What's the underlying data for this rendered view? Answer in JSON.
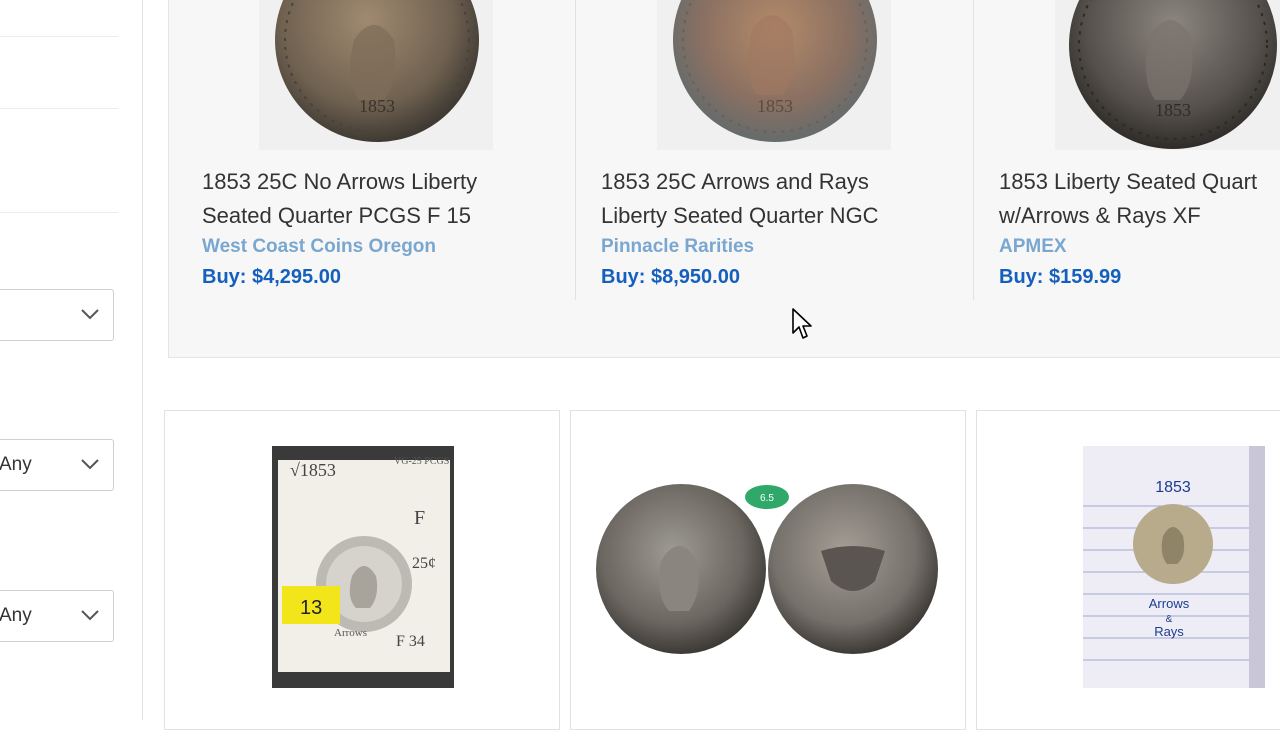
{
  "sidebar": {
    "filters": [
      {
        "value": ""
      },
      {
        "value": "Any"
      },
      {
        "value": "Any"
      }
    ]
  },
  "sponsored": [
    {
      "title_line1": "1853 25C No Arrows Liberty",
      "title_line2": "Seated Quarter PCGS F 15",
      "seller": "West Coast Coins Oregon",
      "price": "Buy: $4,295.00"
    },
    {
      "title_line1": "1853 25C Arrows and Rays",
      "title_line2": "Liberty Seated Quarter NGC",
      "seller": "Pinnacle Rarities",
      "price": "Buy: $8,950.00"
    },
    {
      "title_line1": "1853 Liberty Seated Quart",
      "title_line2": "w/Arrows & Rays XF",
      "seller": "APMEX",
      "price": "Buy: $159.99"
    }
  ],
  "results": [
    {
      "photo_notes": {
        "year": "√1853",
        "grade": "F",
        "denom": "25¢",
        "tag": "13",
        "sub": "Arrows",
        "price_note": "F 34",
        "corner": "VG-25 PCGS"
      }
    },
    {
      "photo_notes": {
        "sticker": "6.5"
      }
    },
    {
      "photo_notes": {
        "year": "1853",
        "caption1": "Arrows",
        "caption2": "&",
        "caption3": "Rays"
      }
    }
  ],
  "colors": {
    "link": "#1560bd",
    "seller": "#7aa7cf",
    "border": "#e2e2e2"
  }
}
